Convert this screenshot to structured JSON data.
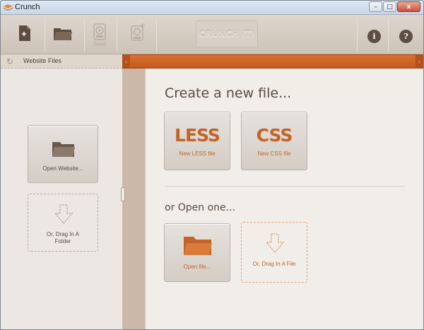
{
  "window": {
    "title": "Crunch"
  },
  "titlebar_controls": {
    "minimize": "–",
    "maximize": "□",
    "close": "x"
  },
  "toolbar": {
    "new_file_icon": "new-file-icon",
    "open_folder_icon": "folder-open-icon",
    "save_label": "Save",
    "save_all_icon": "save-all-icon",
    "crunch_label": "CRUNCH IT!",
    "info_label": "i",
    "help_label": "?"
  },
  "sidebar": {
    "tab_label": "Website Files",
    "open_website_label": "Open Website...",
    "drag_folder_label": "Or, Drag In A Folder"
  },
  "main": {
    "create_heading": "Create a new file...",
    "less_big": "LESS",
    "less_label": "New LESS file",
    "css_big": "CSS",
    "css_label": "New CSS file",
    "open_heading": "or Open one...",
    "open_file_label": "Open file...",
    "drag_file_label": "Or, Drag In A File"
  },
  "colors": {
    "accent": "#c3632a",
    "tab_bar": "#d96f30",
    "icon_dark": "#5d4d42"
  }
}
